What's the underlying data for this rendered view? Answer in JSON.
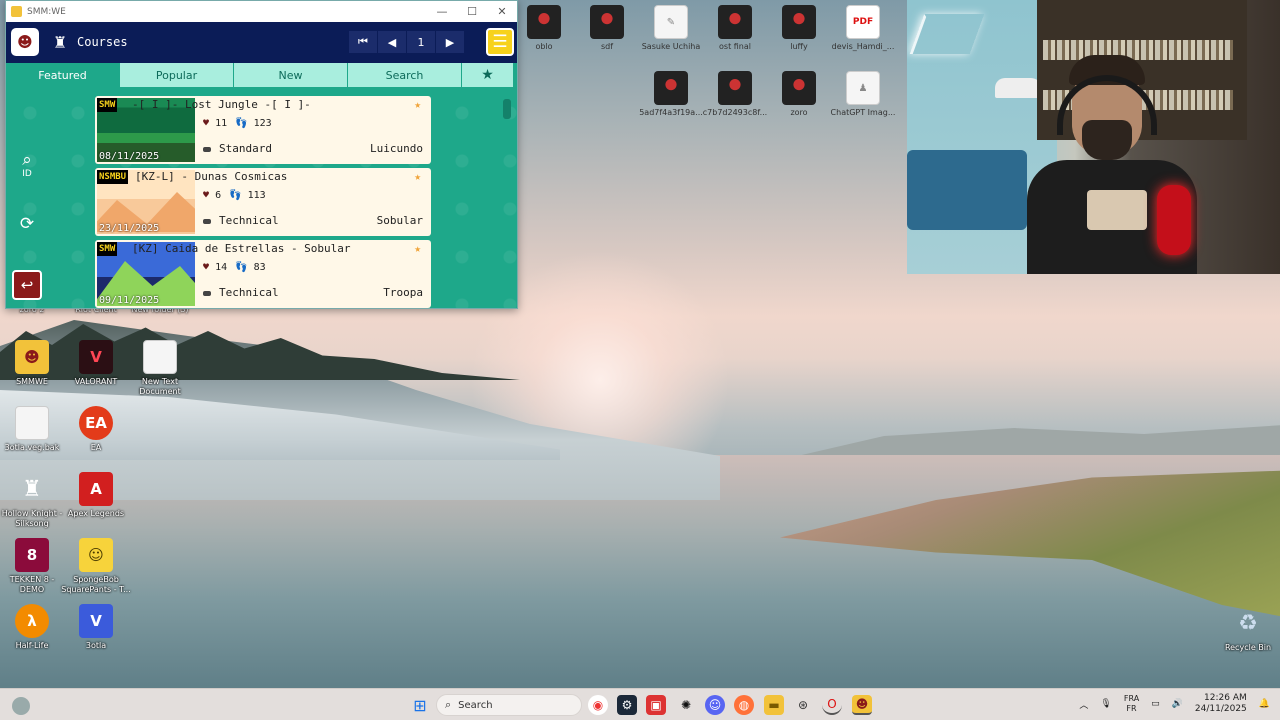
{
  "desktop": {
    "top_icons": [
      {
        "label": "oblo",
        "kind": "char"
      },
      {
        "label": "sdf",
        "kind": "char"
      },
      {
        "label": "Sasuke Uchiha",
        "kind": "doc"
      },
      {
        "label": "ost final",
        "kind": "char"
      },
      {
        "label": "luffy",
        "kind": "char"
      },
      {
        "label": "devis_Hamdi_...",
        "kind": "pdf"
      },
      {
        "label": "5ad7f4a3f19a...",
        "kind": "char"
      },
      {
        "label": "c7b7d2493c8f...",
        "kind": "char"
      },
      {
        "label": "zoro",
        "kind": "char"
      },
      {
        "label": "ChatGPT Imag...",
        "kind": "doc"
      }
    ],
    "partial_labels": [
      "zoro 2",
      "Riot Client",
      "New folder (3)"
    ],
    "left_icons": [
      {
        "label": "SMMWE",
        "glyph": "☻"
      },
      {
        "label": "VALORANT",
        "glyph": "V"
      },
      {
        "label": "New Text Document",
        "glyph": ""
      },
      {
        "label": "3otla.veg.bak",
        "glyph": ""
      },
      {
        "label": "EA",
        "glyph": "EA"
      },
      {
        "label": "Hollow Knight - Silksong",
        "glyph": "♜"
      },
      {
        "label": "Apex Legends",
        "glyph": "A"
      },
      {
        "label": "TEKKEN 8 - DEMO",
        "glyph": "8"
      },
      {
        "label": "SpongeBob SquarePants - T...",
        "glyph": "☺"
      },
      {
        "label": "Half-Life",
        "glyph": "λ"
      },
      {
        "label": "3otla",
        "glyph": "V"
      }
    ],
    "recycle_bin": "Recycle Bin"
  },
  "smm_window": {
    "title": "SMM:WE",
    "header": {
      "section_title": "Courses",
      "page_number": "1",
      "first_icon": "⏮",
      "prev_icon": "◀",
      "next_icon": "▶",
      "menu_icon": "☰"
    },
    "tabs": [
      {
        "label": "Featured",
        "active": true
      },
      {
        "label": "Popular",
        "active": false
      },
      {
        "label": "New",
        "active": false
      },
      {
        "label": "Search",
        "active": false
      }
    ],
    "side_buttons": {
      "search_id_label": "ID"
    },
    "courses": [
      {
        "style": "SMW",
        "title": "-[ I ]- Lost Jungle -[ I ]-",
        "likes": "11",
        "plays": "123",
        "difficulty": "Standard",
        "creator": "Luicundo",
        "date": "08/11/2025",
        "theme": "jungle"
      },
      {
        "style": "NSMBU",
        "title": "[KZ-L] - Dunas Cosmicas",
        "likes": "6",
        "plays": "113",
        "difficulty": "Technical",
        "creator": "Sobular",
        "date": "23/11/2025",
        "theme": "desert"
      },
      {
        "style": "SMW",
        "title": "[KZ] Caida de Estrellas - Sobular",
        "likes": "14",
        "plays": "83",
        "difficulty": "Technical",
        "creator": "Troopa",
        "date": "09/11/2025",
        "theme": "hills"
      }
    ]
  },
  "taskbar": {
    "search_placeholder": "Search",
    "lang_top": "FRA",
    "lang_bottom": "FR",
    "time": "12:26 AM",
    "date": "24/11/2025"
  },
  "colors": {
    "smm_green": "#1ea88a",
    "smm_navy": "#0b1c57",
    "card_bg": "#fff8e8",
    "accent_yellow": "#f7d21c",
    "back_button": "#8b1a1a"
  }
}
